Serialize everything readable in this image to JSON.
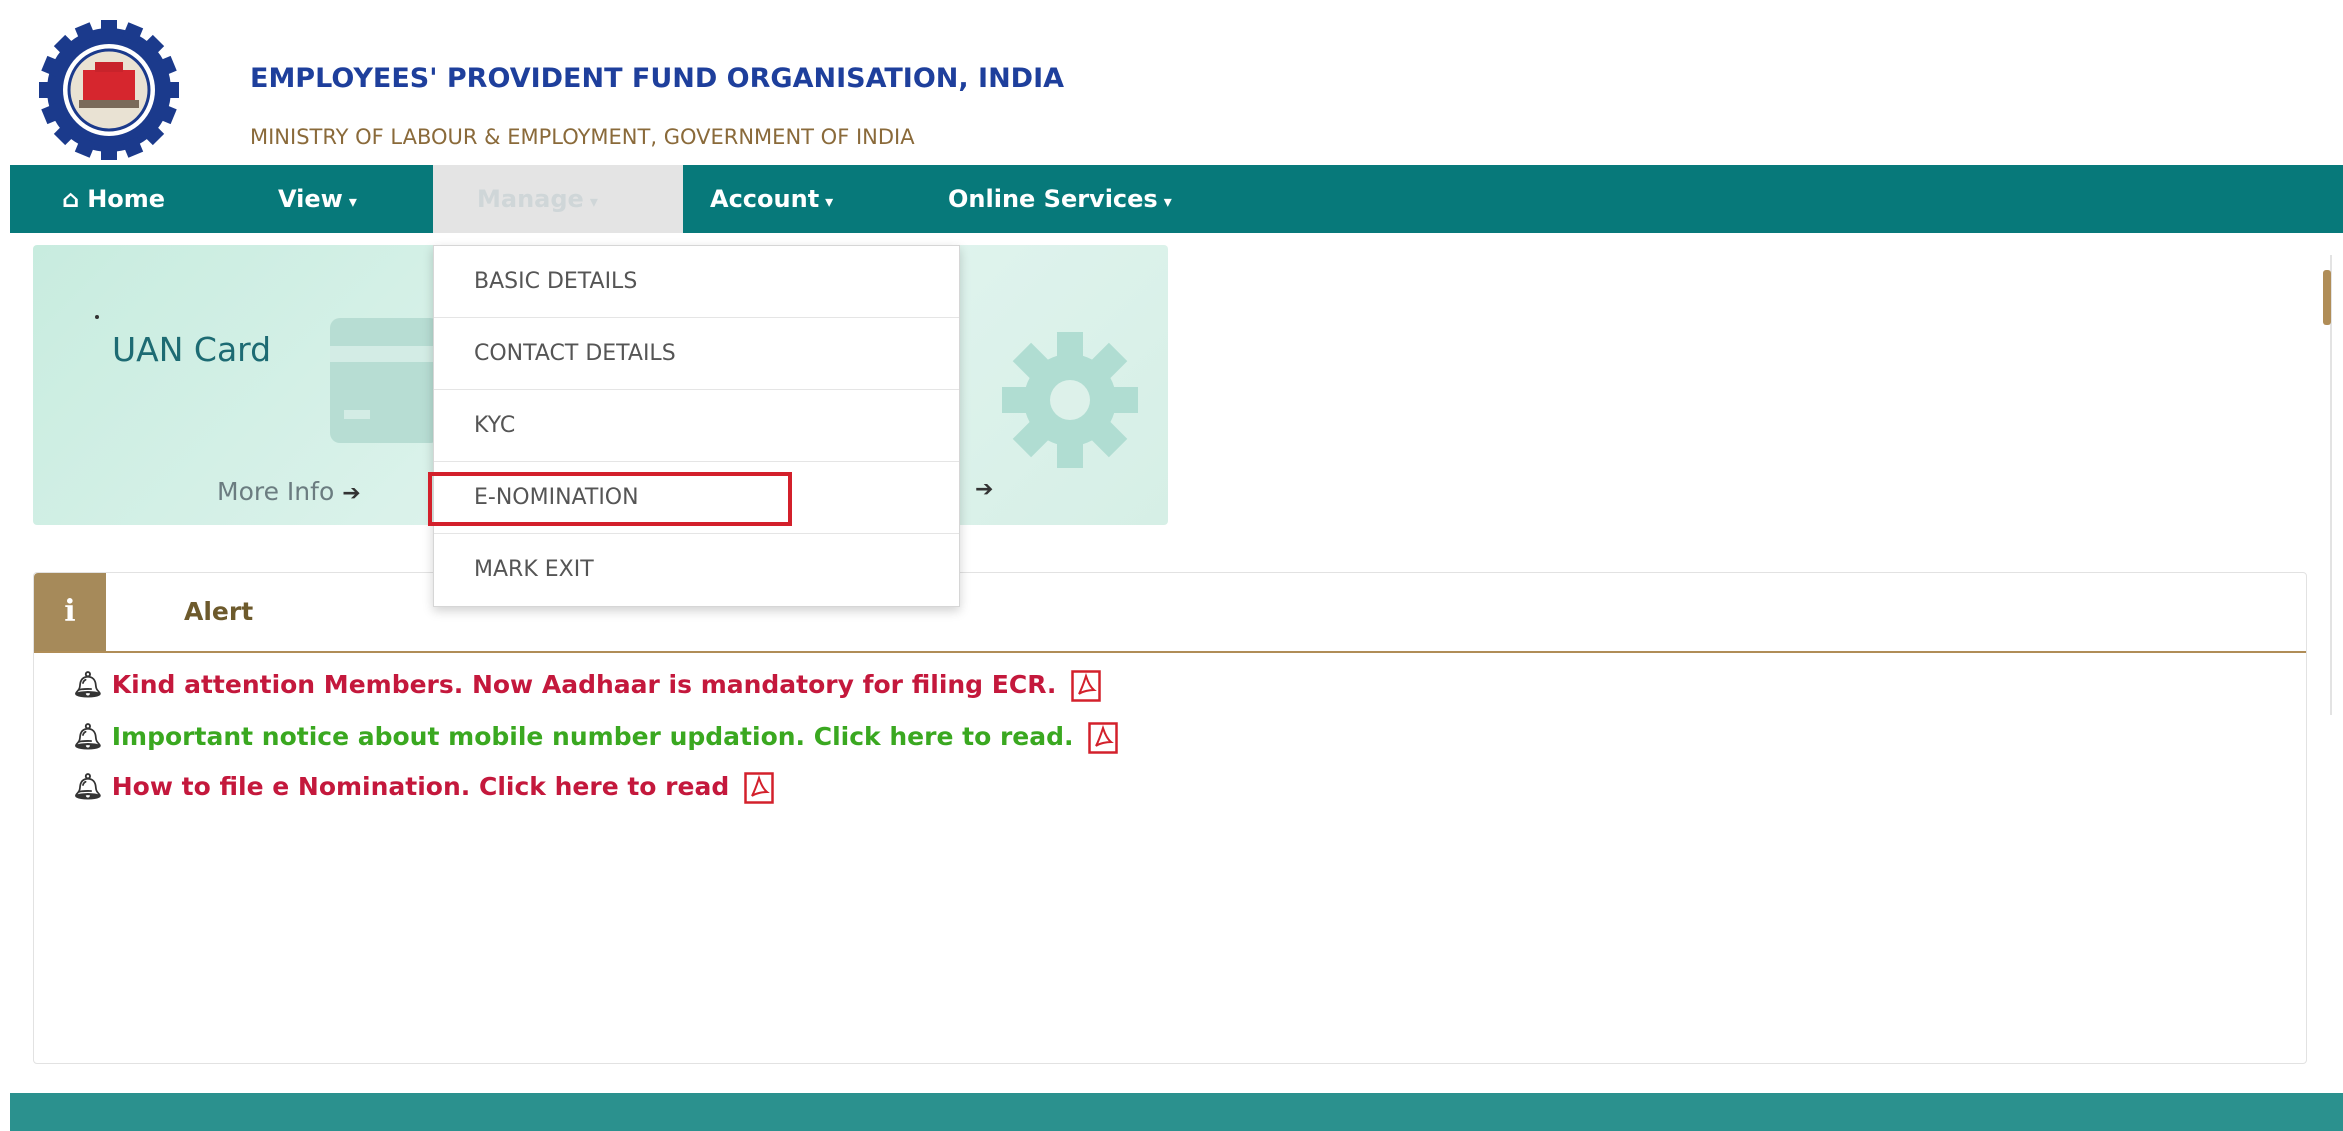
{
  "header": {
    "org_title": "EMPLOYEES' PROVIDENT FUND ORGANISATION, INDIA",
    "org_subtitle": "MINISTRY OF LABOUR & EMPLOYMENT, GOVERNMENT OF INDIA",
    "logo_icon": "epfo-emblem-icon"
  },
  "nav": {
    "home": "Home",
    "view": "View",
    "manage": "Manage",
    "account": "Account",
    "online_services": "Online Services",
    "caret": "▾"
  },
  "manage_menu": {
    "items": [
      "BASIC DETAILS",
      "CONTACT DETAILS",
      "KYC",
      "E-NOMINATION",
      "MARK EXIT"
    ],
    "highlighted": "E-NOMINATION"
  },
  "card": {
    "title": "UAN Card",
    "more_info": "More Info",
    "arrow": "➔"
  },
  "alert": {
    "icon_letter": "i",
    "title": "Alert",
    "notices": [
      {
        "text": "Kind attention Members. Now Aadhaar is mandatory for filing ECR.",
        "color": "#c4183c"
      },
      {
        "text": "Important notice about mobile number updation. Click here to read.",
        "color": "#3aa820"
      },
      {
        "text": "How to file e Nomination. Click here to read",
        "color": "#c4183c"
      }
    ]
  },
  "colors": {
    "nav_bg": "#07797a",
    "footer_bg": "#2b918e",
    "highlight_border": "#d3202b",
    "alert_accent": "#a68a5a"
  }
}
